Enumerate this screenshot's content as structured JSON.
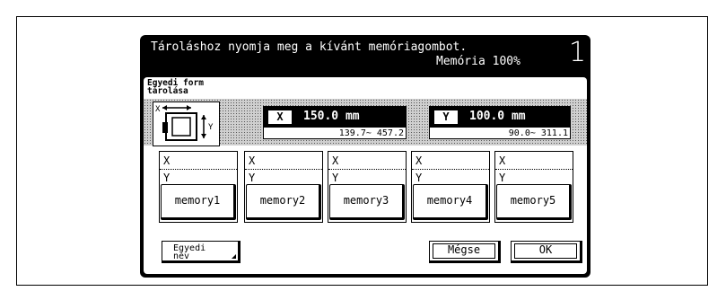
{
  "header": {
    "message": "Tároláshoz nyomja meg a kívánt memóriagombot.",
    "memory": "Memória 100%",
    "number": "1"
  },
  "screen": {
    "title_line1": "Egyedi form",
    "title_line2": "tárolása"
  },
  "diagram": {
    "x_label": "X",
    "y_label": "Y"
  },
  "x_value": {
    "axis": "X",
    "value": "150.0 mm",
    "range": "139.7~ 457.2"
  },
  "y_value": {
    "axis": "Y",
    "value": "100.0 mm",
    "range": "90.0~ 311.1"
  },
  "memories": [
    {
      "x": "X",
      "y": "Y",
      "label": "memory1"
    },
    {
      "x": "X",
      "y": "Y",
      "label": "memory2"
    },
    {
      "x": "X",
      "y": "Y",
      "label": "memory3"
    },
    {
      "x": "X",
      "y": "Y",
      "label": "memory4"
    },
    {
      "x": "X",
      "y": "Y",
      "label": "memory5"
    }
  ],
  "buttons": {
    "name_line1": "Egyedi",
    "name_line2": "név",
    "cancel": "Mégse",
    "ok": "OK"
  }
}
